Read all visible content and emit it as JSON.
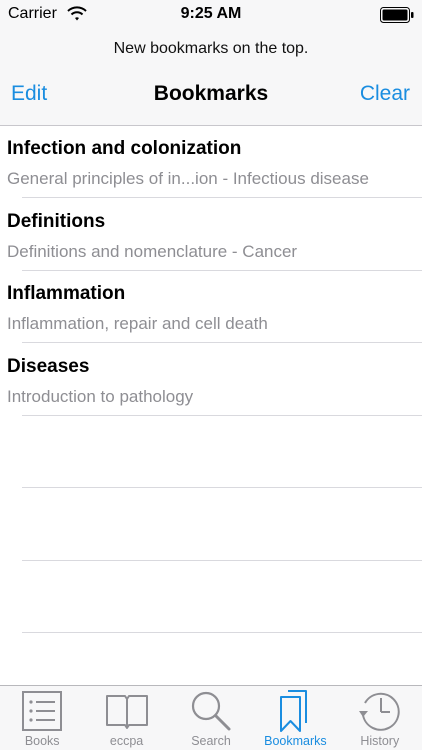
{
  "status_bar": {
    "carrier": "Carrier",
    "time": "9:25 AM",
    "icons": [
      "wifi-icon",
      "battery-icon"
    ]
  },
  "prompt": "New bookmarks on the top.",
  "nav": {
    "left_button": "Edit",
    "title": "Bookmarks",
    "right_button": "Clear"
  },
  "bookmarks": [
    {
      "title": "Infection and colonization",
      "subtitle": "General principles of in...ion - Infectious disease"
    },
    {
      "title": "Definitions",
      "subtitle": "Definitions and nomenclature - Cancer"
    },
    {
      "title": "Inflammation",
      "subtitle": "Inflammation, repair and cell death"
    },
    {
      "title": "Diseases",
      "subtitle": "Introduction to pathology"
    }
  ],
  "tabs": [
    {
      "label": "Books",
      "icon": "list-icon",
      "active": false
    },
    {
      "label": "eccpa",
      "icon": "open-book-icon",
      "active": false
    },
    {
      "label": "Search",
      "icon": "magnifier-icon",
      "active": false
    },
    {
      "label": "Bookmarks",
      "icon": "bookmarks-icon",
      "active": true
    },
    {
      "label": "History",
      "icon": "clock-history-icon",
      "active": false
    }
  ],
  "colors": {
    "accent": "#1a8de0",
    "inactive": "#8e8e93",
    "bar_background": "#f7f7f8"
  }
}
